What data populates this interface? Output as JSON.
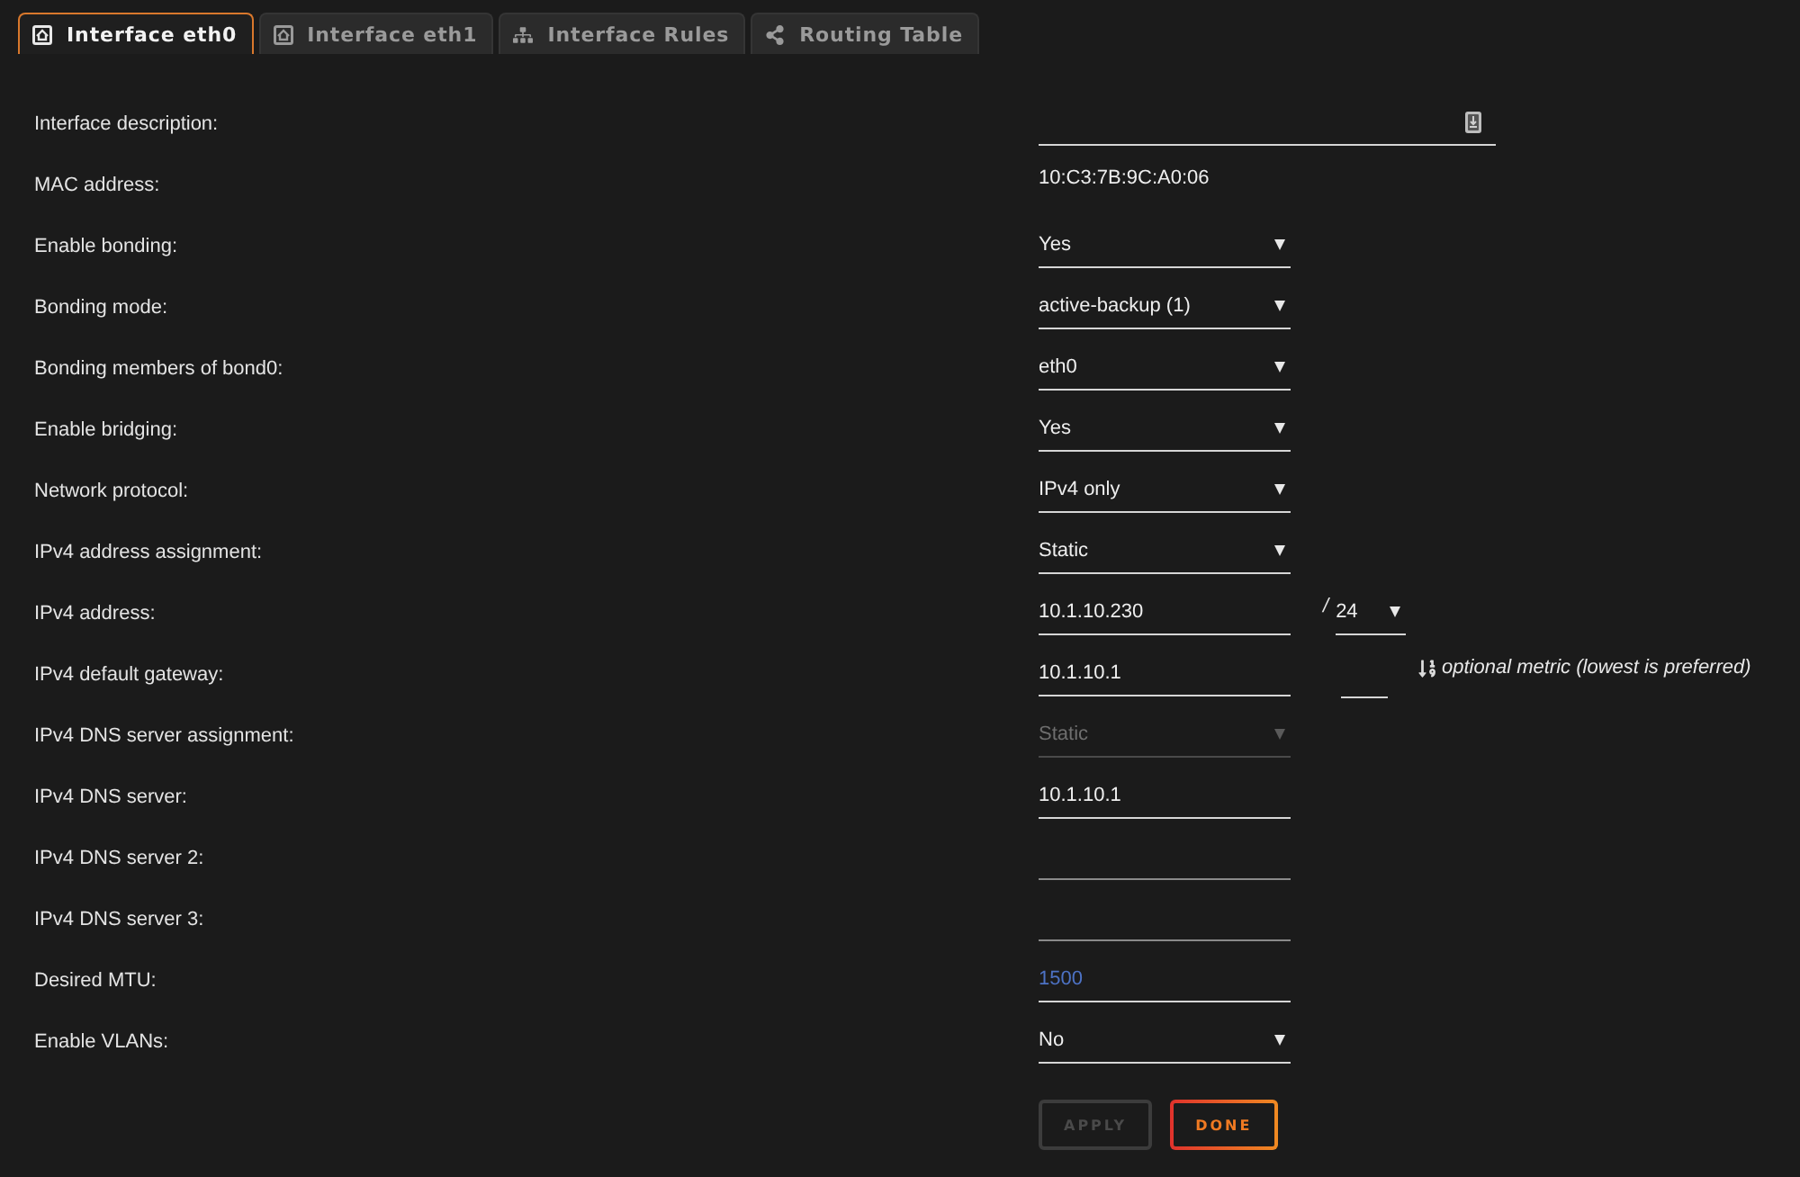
{
  "tabs": [
    {
      "label": "Interface eth0",
      "selected": true
    },
    {
      "label": "Interface eth1",
      "selected": false
    },
    {
      "label": "Interface Rules",
      "selected": false
    },
    {
      "label": "Routing Table",
      "selected": false
    }
  ],
  "form": {
    "rows": [
      {
        "label": "Interface description:",
        "kind": "wide-text",
        "disabled": false
      },
      {
        "label": "MAC address:",
        "kind": "static",
        "value": "10:C3:7B:9C:A0:06",
        "disabled": false
      },
      {
        "label": "Enable bonding:",
        "kind": "select",
        "value": "Yes",
        "disabled": false
      },
      {
        "label": "Bonding mode:",
        "kind": "select",
        "value": "active-backup (1)",
        "disabled": false
      },
      {
        "label": "Bonding members of bond0:",
        "kind": "select",
        "value": "eth0",
        "disabled": false
      },
      {
        "label": "Enable bridging:",
        "kind": "select",
        "value": "Yes",
        "disabled": false
      },
      {
        "label": "Network protocol:",
        "kind": "select",
        "value": "IPv4 only",
        "disabled": false
      },
      {
        "label": "IPv4 address assignment:",
        "kind": "select",
        "value": "Static",
        "disabled": false
      },
      {
        "label": "IPv4 address:",
        "kind": "text",
        "value": "10.1.10.230",
        "disabled": false,
        "prefix_length": {
          "separator": "/",
          "value": "24"
        }
      },
      {
        "label": "IPv4 default gateway:",
        "kind": "text",
        "value": "10.1.10.1",
        "disabled": false,
        "metric": {
          "hint": "optional metric (lowest is preferred)"
        }
      },
      {
        "label": "IPv4 DNS server assignment:",
        "kind": "select",
        "value": "Static",
        "disabled": true
      },
      {
        "label": "IPv4 DNS server:",
        "kind": "text",
        "value": "10.1.10.1",
        "disabled": false
      },
      {
        "label": "IPv4 DNS server 2:",
        "kind": "text",
        "disabled": false
      },
      {
        "label": "IPv4 DNS server 3:",
        "kind": "text",
        "disabled": false
      },
      {
        "label": "Desired MTU:",
        "kind": "text",
        "placeholder": "1500",
        "disabled": false
      },
      {
        "label": "Enable VLANs:",
        "kind": "select",
        "value": "No",
        "disabled": false
      }
    ]
  },
  "buttons": [
    {
      "label": "APPLY",
      "disabled": true
    },
    {
      "label": "DONE",
      "disabled": false
    }
  ]
}
